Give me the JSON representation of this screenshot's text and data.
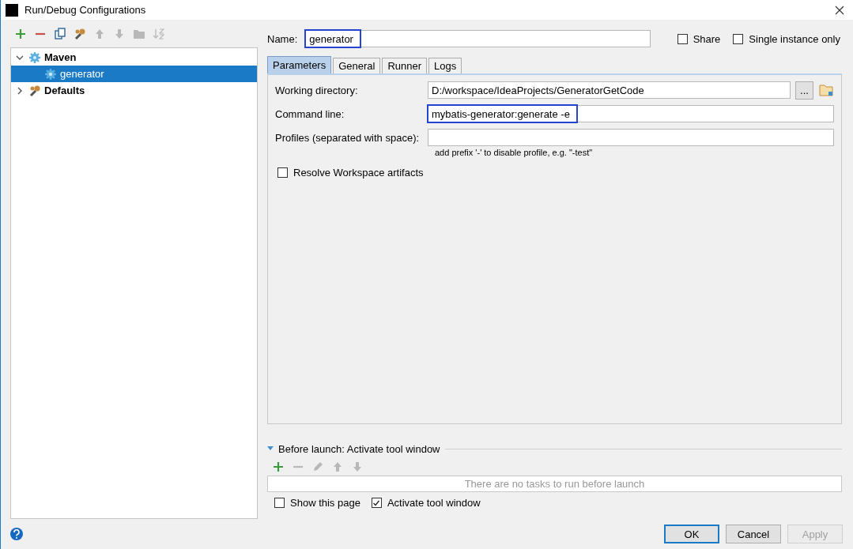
{
  "window": {
    "title": "Run/Debug Configurations"
  },
  "toolbar": [
    {
      "kind": "add",
      "disabled": false
    },
    {
      "kind": "remove",
      "disabled": false
    },
    {
      "kind": "copy",
      "disabled": false
    },
    {
      "kind": "wrench",
      "disabled": false
    },
    {
      "kind": "up",
      "disabled": true
    },
    {
      "kind": "down",
      "disabled": true
    },
    {
      "kind": "folder",
      "disabled": true
    },
    {
      "kind": "sort",
      "disabled": true
    }
  ],
  "tree": [
    {
      "label": "Maven",
      "kind": "maven",
      "expanded": true,
      "selected": false,
      "children": [
        {
          "label": "generator",
          "kind": "maven",
          "selected": true
        }
      ]
    },
    {
      "label": "Defaults",
      "kind": "wrench",
      "expanded": false,
      "selected": false
    }
  ],
  "name_field": {
    "label": "Name:",
    "value": "generator",
    "highlighted": true
  },
  "options": [
    {
      "label": "Share",
      "checked": false
    },
    {
      "label": "Single instance only",
      "checked": false
    }
  ],
  "tabs": [
    {
      "label": "Parameters",
      "selected": true
    },
    {
      "label": "General",
      "selected": false
    },
    {
      "label": "Runner",
      "selected": false
    },
    {
      "label": "Logs",
      "selected": false
    }
  ],
  "fields": [
    {
      "label": "Working directory:",
      "value": "D:/workspace/IdeaProjects/GeneratorGetCode",
      "kind": "browse",
      "browse_label": "...",
      "highlighted": false
    },
    {
      "label": "Command line:",
      "value": "mybatis-generator:generate -e",
      "kind": "plain",
      "highlighted": true
    },
    {
      "label": "Profiles (separated with space):",
      "kind": "plain",
      "highlighted": false,
      "hint": "add prefix '-' to disable profile, e.g. \"-test\""
    }
  ],
  "resolve_checkbox": {
    "label": "Resolve Workspace artifacts",
    "checked": false
  },
  "before_launch": {
    "title": "Before launch: Activate tool window",
    "expanded": true,
    "toolbar": [
      {
        "kind": "add",
        "disabled": false
      },
      {
        "kind": "remove",
        "disabled": true
      },
      {
        "kind": "edit",
        "disabled": true
      },
      {
        "kind": "up",
        "disabled": true
      },
      {
        "kind": "down",
        "disabled": true
      }
    ],
    "empty_text": "There are no tasks to run before launch"
  },
  "bottom_checks": [
    {
      "label": "Show this page",
      "checked": false
    },
    {
      "label": "Activate tool window",
      "checked": true
    }
  ],
  "buttons": [
    {
      "label": "OK",
      "kind": "default",
      "disabled": false
    },
    {
      "label": "Cancel",
      "kind": "normal",
      "disabled": false
    },
    {
      "label": "Apply",
      "kind": "normal",
      "disabled": true
    }
  ]
}
